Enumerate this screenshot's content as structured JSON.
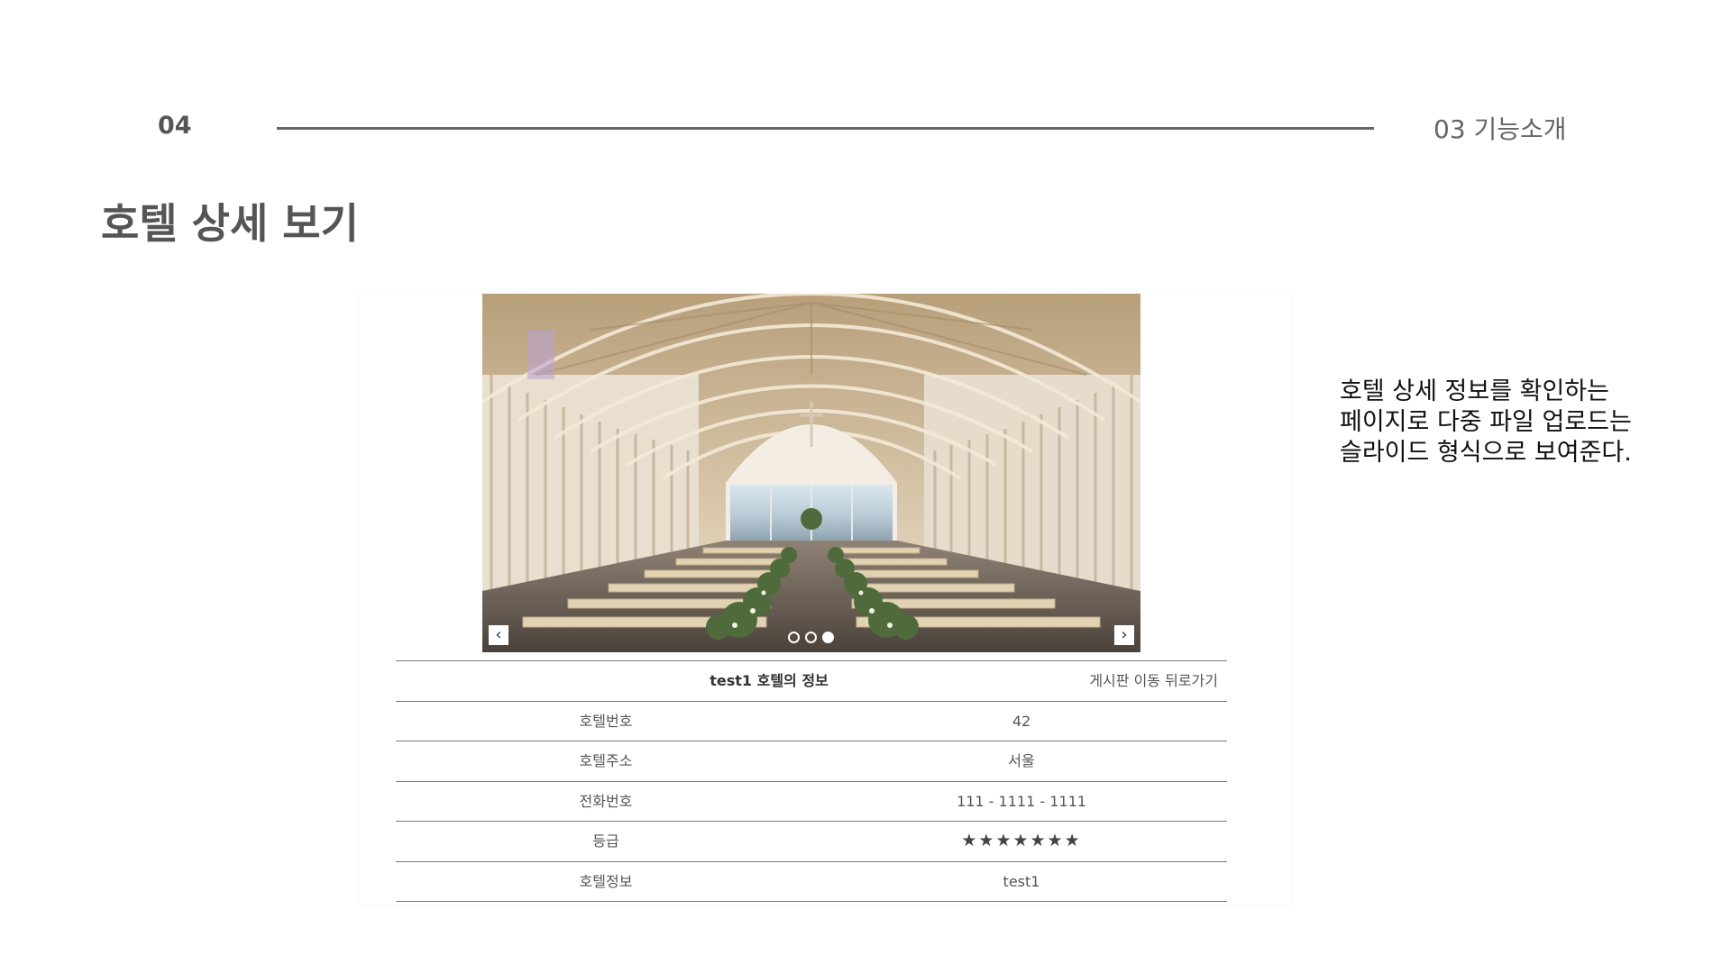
{
  "slide": {
    "page_number": "04",
    "section": "03 기능소개",
    "title": "호텔 상세 보기",
    "description_lines": [
      "호텔 상세 정보를 확인하는",
      "페이지로 다중 파일 업로드는",
      "슬라이드 형식으로 보여준다."
    ]
  },
  "carousel": {
    "image": "chapel-interior-photo",
    "prev_icon": "chevron-left-icon",
    "next_icon": "chevron-right-icon",
    "prev_glyph": "‹",
    "next_glyph": "›",
    "dot_count": 3,
    "active_dot_index": 2
  },
  "hotel_table": {
    "title": "test1 호텔의 정보",
    "link_board": "게시판 이동",
    "link_back": "뒤로가기",
    "rows": [
      {
        "label": "호텔번호",
        "value": "42"
      },
      {
        "label": "호텔주소",
        "value": "서울"
      },
      {
        "label": "전화번호",
        "value": "111 - 1111 - 1111"
      },
      {
        "label": "등급",
        "value": "★★★★★★★",
        "rating": 7
      },
      {
        "label": "호텔정보",
        "value": "test1"
      }
    ]
  },
  "colors": {
    "text_gray": "#555555",
    "rule_gray": "#666666",
    "description_text": "#111111"
  }
}
